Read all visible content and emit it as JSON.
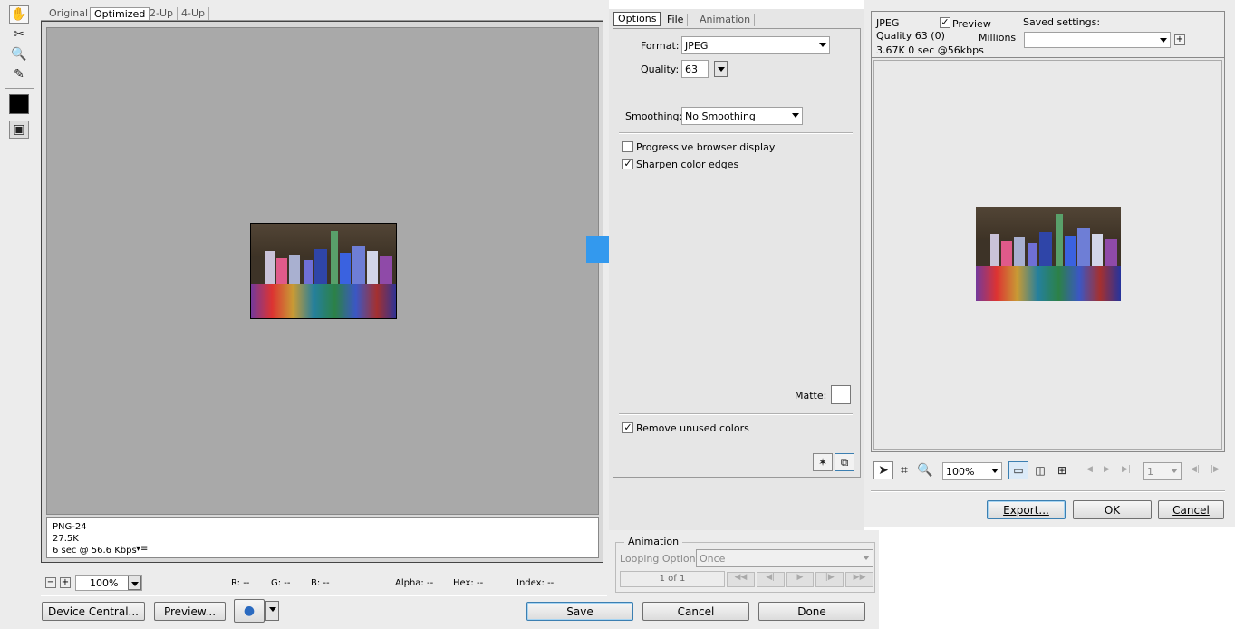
{
  "left": {
    "view_tabs": [
      "Original",
      "Optimized",
      "2-Up",
      "4-Up"
    ],
    "info": {
      "format": "PNG-24",
      "size": "27.5K",
      "time": "6 sec @ 56.6 Kbps"
    },
    "zoom": "100%",
    "readouts": {
      "r": "R: --",
      "g": "G: --",
      "b": "B: --",
      "alpha": "Alpha: --",
      "hex": "Hex: --",
      "index": "Index: --"
    },
    "buttons": {
      "device_central": "Device Central...",
      "preview": "Preview...",
      "save": "Save",
      "cancel": "Cancel",
      "done": "Done"
    }
  },
  "options": {
    "tabs": [
      "Options",
      "File",
      "Animation"
    ],
    "format_label": "Format:",
    "format_value": "JPEG",
    "quality_label": "Quality:",
    "quality_value": "63",
    "smoothing_label": "Smoothing:",
    "smoothing_value": "No Smoothing",
    "progressive_label": "Progressive browser display",
    "progressive_checked": false,
    "sharpen_label": "Sharpen color edges",
    "sharpen_checked": true,
    "matte_label": "Matte:",
    "remove_unused_label": "Remove unused colors",
    "remove_unused_checked": true
  },
  "animation": {
    "title": "Animation",
    "looping_label": "Looping Options:",
    "looping_value": "Once",
    "frame_counter": "1 of 1"
  },
  "right": {
    "info_format": "JPEG",
    "info_quality": "Quality 63 (0)",
    "info_size_time": "3.67K  0 sec @56kbps",
    "preview_label": "Preview",
    "preview_checked": true,
    "millions": "Millions",
    "saved_settings_label": "Saved settings:",
    "zoom": "100%",
    "frame_field": "1",
    "buttons": {
      "export": "Export...",
      "ok": "OK",
      "cancel": "Cancel"
    }
  },
  "colors": {
    "arrow": "#3399ee",
    "canvas_gray": "#a9a9a9",
    "preview_bg": "#e9e9e9"
  }
}
